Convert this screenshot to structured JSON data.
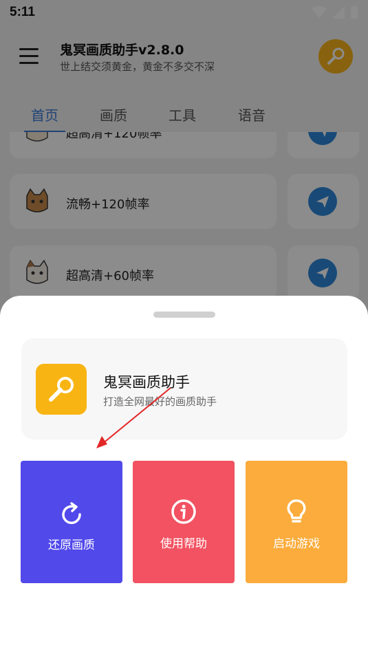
{
  "status_bar": {
    "time": "5:11"
  },
  "app": {
    "title": "鬼冥画质助手v2.8.0",
    "subtitle": "世上结交须黄金，黄金不多交不深",
    "accent": "#3c7bd8",
    "avatar_icon": "wrench-icon"
  },
  "tabs": [
    {
      "label": "首页",
      "active": true
    },
    {
      "label": "画质",
      "active": false
    },
    {
      "label": "工具",
      "active": false
    },
    {
      "label": "语音",
      "active": false
    }
  ],
  "list_items": [
    {
      "label": "超高清+120帧率",
      "icon": "cat-icon"
    },
    {
      "label": "流畅+120帧率",
      "icon": "cat-icon"
    },
    {
      "label": "超高清+60帧率",
      "icon": "cat-icon"
    }
  ],
  "sheet": {
    "app_name": "鬼冥画质助手",
    "app_desc": "打造全网最好的画质助手",
    "actions": [
      {
        "label": "还原画质",
        "icon": "refresh-icon",
        "color": "#5149ea"
      },
      {
        "label": "使用帮助",
        "icon": "info-icon",
        "color": "#f25261"
      },
      {
        "label": "启动游戏",
        "icon": "lightbulb-icon",
        "color": "#fbac3c"
      }
    ]
  }
}
